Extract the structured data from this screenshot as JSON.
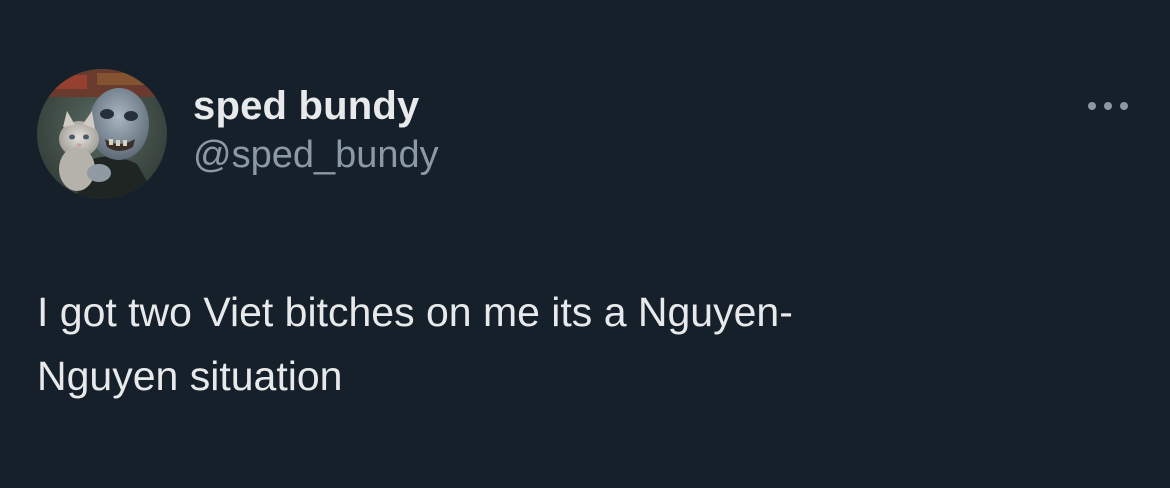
{
  "tweet": {
    "author": {
      "display_name": "sped bundy",
      "handle": "@sped_bundy",
      "avatar_icon": "profile-photo"
    },
    "more_icon": "ellipsis-icon",
    "text": "I got two Viet bitches on me its a Nguyen-\nNguyen situation"
  },
  "colors": {
    "background": "#15202b",
    "text": "#e7e9ea",
    "secondary_text": "#8b98a5"
  }
}
